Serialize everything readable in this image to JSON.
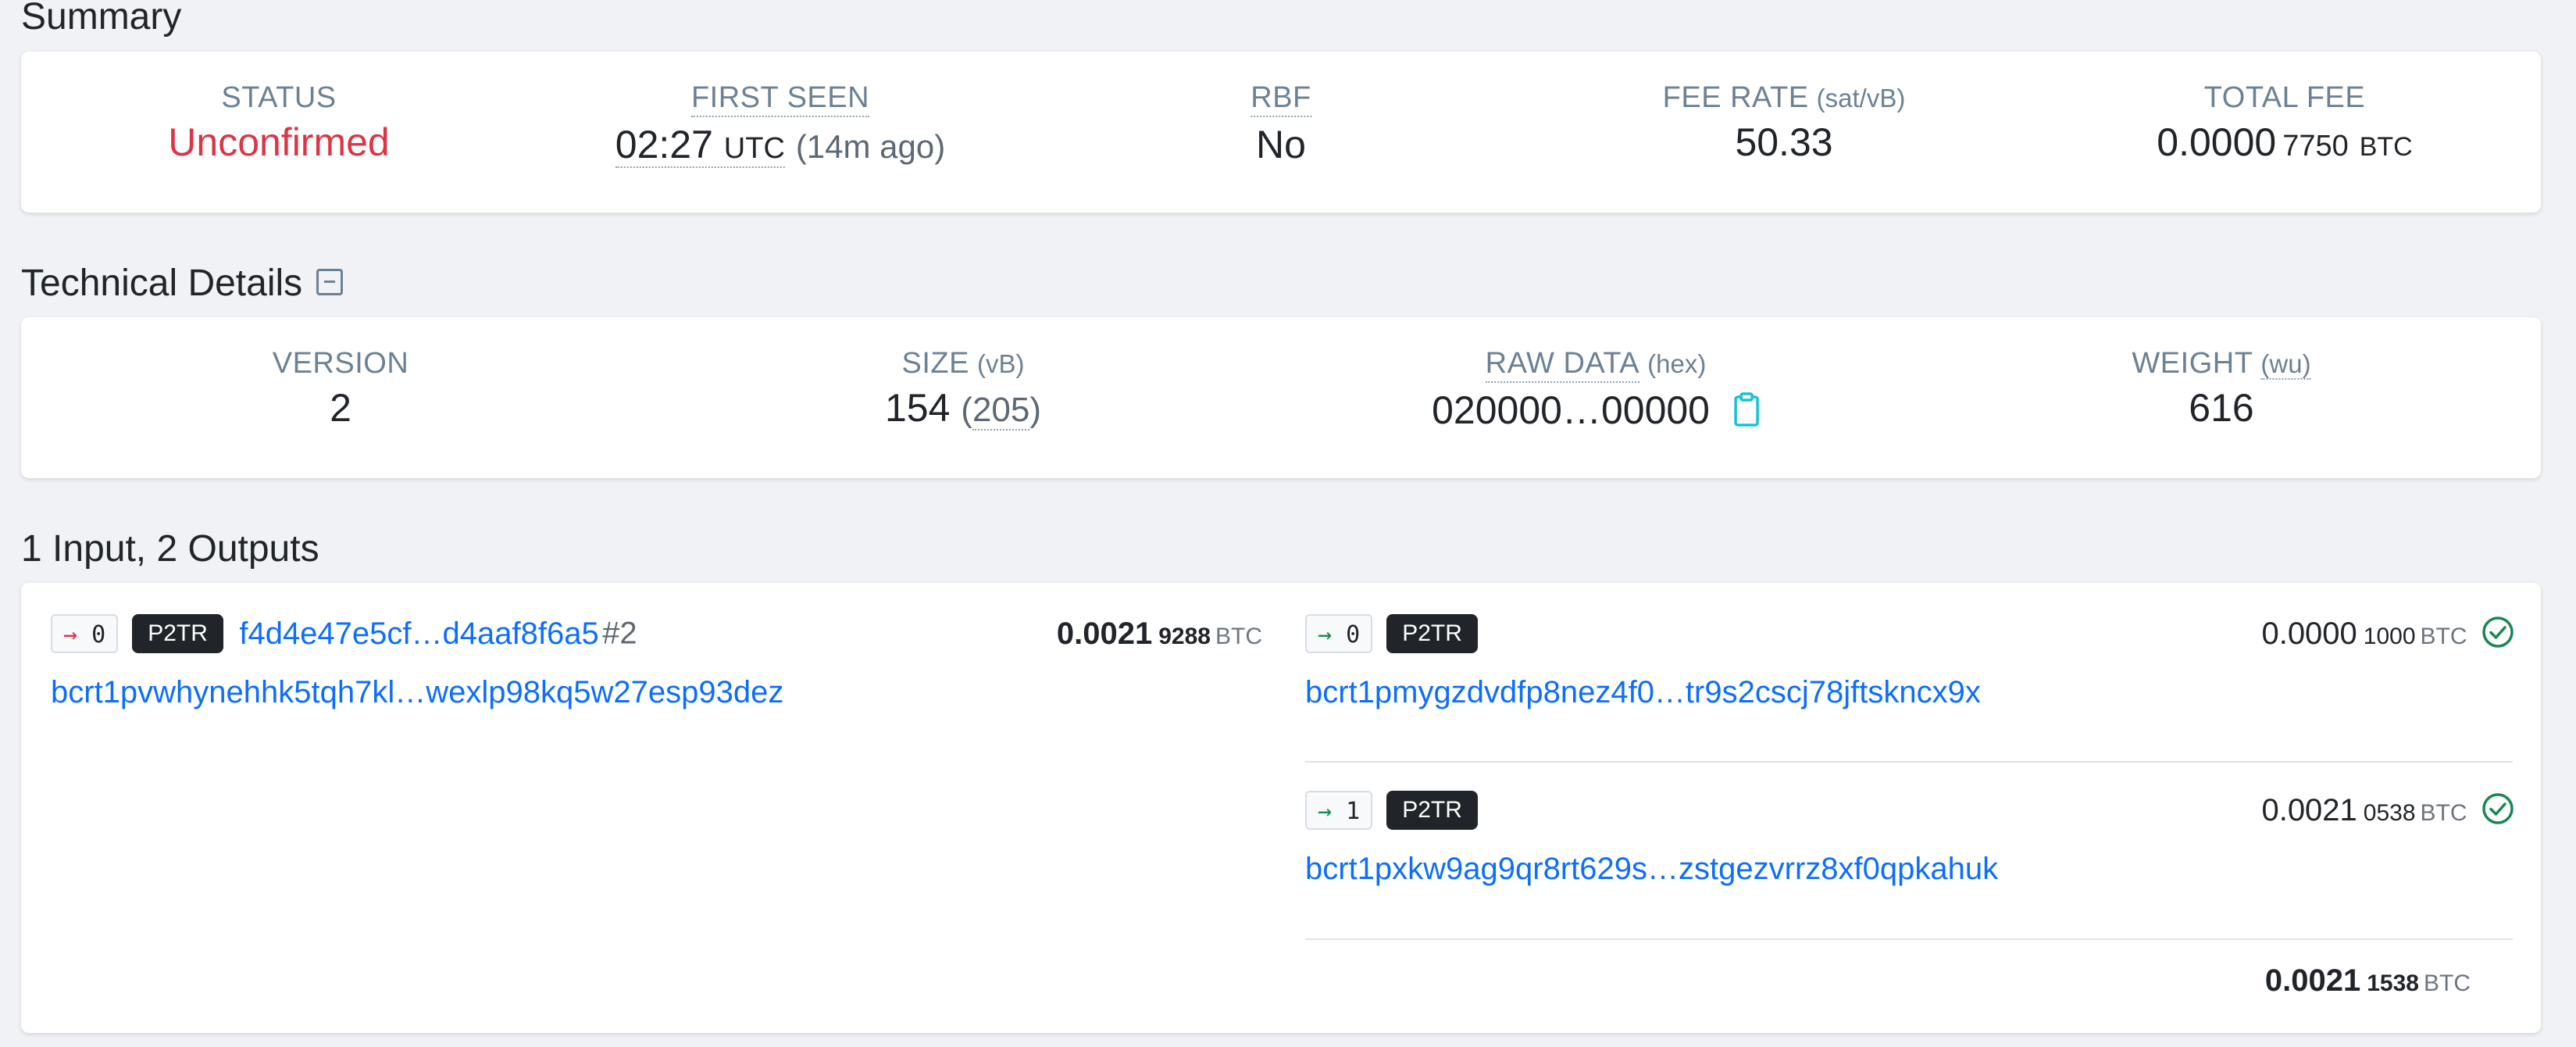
{
  "summary": {
    "title": "Summary",
    "status": {
      "label": "STATUS",
      "value": "Unconfirmed"
    },
    "first_seen": {
      "label": "FIRST SEEN",
      "time": "02:27",
      "tz": "UTC",
      "ago": "(14m ago)"
    },
    "rbf": {
      "label": "RBF",
      "value": "No"
    },
    "fee_rate": {
      "label": "FEE RATE",
      "unit": "(sat/vB)",
      "value": "50.33"
    },
    "total_fee": {
      "label": "TOTAL FEE",
      "main": "0.0000",
      "sub": "7750",
      "unit": "BTC"
    }
  },
  "technical": {
    "title": "Technical Details",
    "version": {
      "label": "VERSION",
      "value": "2"
    },
    "size": {
      "label": "SIZE",
      "unit": "(vB)",
      "value": "154",
      "paren": "205"
    },
    "raw": {
      "label": "RAW DATA",
      "unit": "(hex)",
      "value": "020000…00000"
    },
    "weight": {
      "label": "WEIGHT",
      "unit": "(wu)",
      "value": "616"
    }
  },
  "io": {
    "title": "1 Input, 2 Outputs",
    "input": {
      "index": "0",
      "type": "P2TR",
      "txid": "f4d4e47e5cf…d4aaf8f6a5",
      "vout": "#2",
      "amount_main": "0.0021",
      "amount_sub": "9288",
      "unit": "BTC",
      "address": "bcrt1pvwhynehhk5tqh7kl…wexlp98kq5w27esp93dez"
    },
    "outputs": [
      {
        "index": "0",
        "type": "P2TR",
        "amount_main": "0.0000",
        "amount_sub": "1000",
        "unit": "BTC",
        "address": "bcrt1pmygzdvdfp8nez4f0…tr9s2cscj78jftskncx9x"
      },
      {
        "index": "1",
        "type": "P2TR",
        "amount_main": "0.0021",
        "amount_sub": "0538",
        "unit": "BTC",
        "address": "bcrt1pxkw9ag9qr8rt629s…zstgezvrrz8xf0qpkahuk"
      }
    ],
    "total": {
      "main": "0.0021",
      "sub": "1538",
      "unit": "BTC"
    }
  },
  "colors": {
    "unconfirmed": "#dc3545",
    "link": "#0d6efd",
    "label": "#6c8193",
    "check": "#198754"
  }
}
